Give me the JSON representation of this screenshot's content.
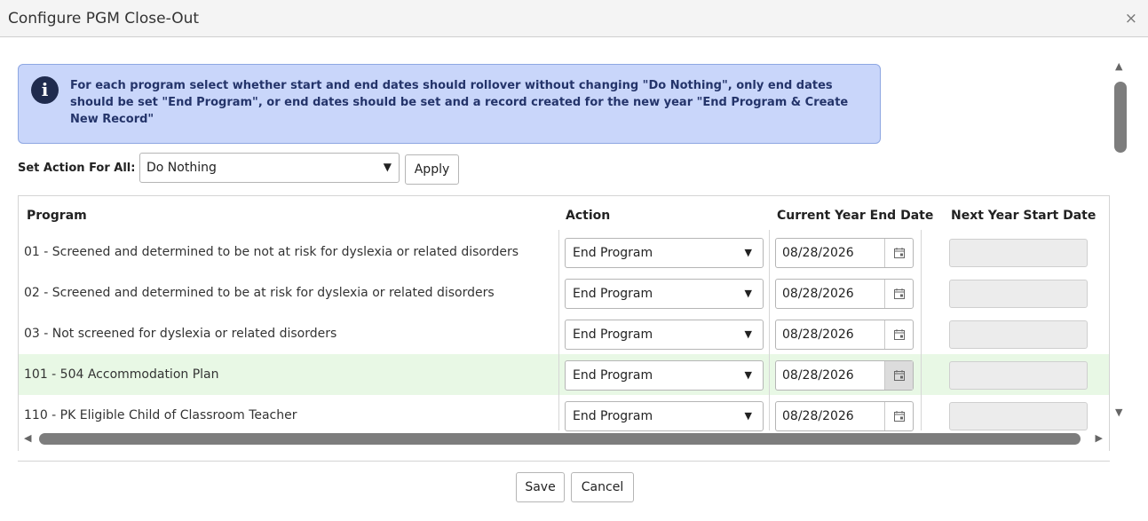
{
  "dialog": {
    "title": "Configure PGM Close-Out",
    "close_glyph": "×"
  },
  "info": {
    "icon": "info-circle-icon",
    "text": "For each program select whether start and end dates should rollover without changing \"Do Nothing\", only end dates should be set \"End Program\", or end dates should be set and a record created for the new year \"End Program & Create New Record\""
  },
  "set_all": {
    "label": "Set Action For All:",
    "value": "Do Nothing",
    "apply_label": "Apply"
  },
  "grid": {
    "columns": [
      "Program",
      "Action",
      "Current Year End Date",
      "Next Year Start Date"
    ],
    "rows": [
      {
        "program": "01 - Screened and determined to be not at risk for dyslexia or related disorders",
        "action": "End Program",
        "end_date": "08/28/2026",
        "next_start": ""
      },
      {
        "program": "02 - Screened and determined to be at risk for dyslexia or related disorders",
        "action": "End Program",
        "end_date": "08/28/2026",
        "next_start": ""
      },
      {
        "program": "03 - Not screened for dyslexia or related disorders",
        "action": "End Program",
        "end_date": "08/28/2026",
        "next_start": ""
      },
      {
        "program": "101 - 504 Accommodation Plan",
        "action": "End Program",
        "end_date": "08/28/2026",
        "next_start": ""
      },
      {
        "program": "110 - PK Eligible Child of Classroom Teacher",
        "action": "End Program",
        "end_date": "08/28/2026",
        "next_start": ""
      }
    ],
    "selected_row": 3
  },
  "footer": {
    "save_label": "Save",
    "cancel_label": "Cancel"
  },
  "glyphs": {
    "dropdown": "▼",
    "arrow_up": "▲",
    "arrow_down": "▼",
    "arrow_left": "◀",
    "arrow_right": "▶"
  },
  "colors": {
    "info_bg": "#c9d6fa",
    "info_text": "#24346a",
    "selected_row": "#e8f8e5"
  }
}
